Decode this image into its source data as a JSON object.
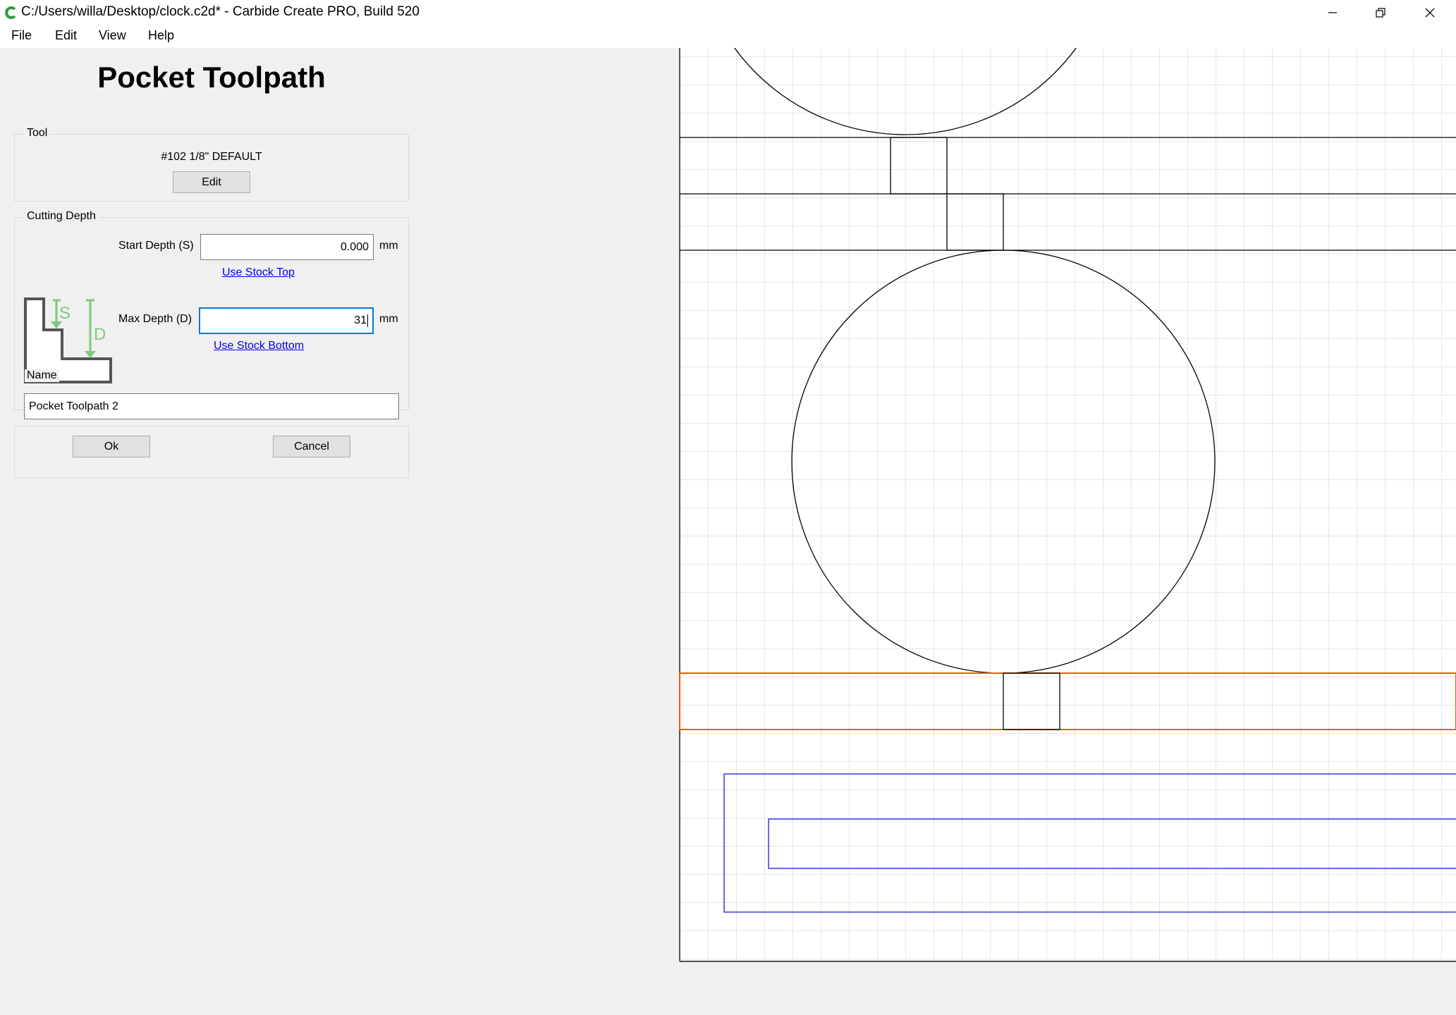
{
  "window": {
    "title": "C:/Users/willa/Desktop/clock.c2d* - Carbide Create PRO, Build 520",
    "icons": [
      "app-logo-icon",
      "minimize-icon",
      "restore-icon",
      "close-icon"
    ]
  },
  "menu": {
    "file": "File",
    "edit": "Edit",
    "view": "View",
    "help": "Help"
  },
  "panel": {
    "title": "Pocket Toolpath",
    "tool": {
      "group_label": "Tool",
      "name": "#102 1/8\" DEFAULT",
      "edit_label": "Edit"
    },
    "cutting_depth": {
      "group_label": "Cutting Depth",
      "diagram_letters": {
        "start": "S",
        "max": "D"
      },
      "start_label": "Start Depth (S)",
      "start_value": "0.000",
      "start_unit": "mm",
      "use_stock_top": "Use Stock Top",
      "max_label": "Max Depth (D)",
      "max_value": "31",
      "max_unit": "mm",
      "use_stock_bottom": "Use Stock Bottom"
    },
    "name": {
      "group_label": "Name",
      "value": "Pocket Toolpath 2"
    },
    "ok_label": "Ok",
    "cancel_label": "Cancel"
  },
  "colors": {
    "grid": "#cccccc",
    "geometry": "#000000",
    "selected": "#e8600a",
    "toolpath": "#3838e0",
    "diagram_green": "#7fc97f",
    "focus": "#0078d7",
    "link": "#0000ee"
  }
}
